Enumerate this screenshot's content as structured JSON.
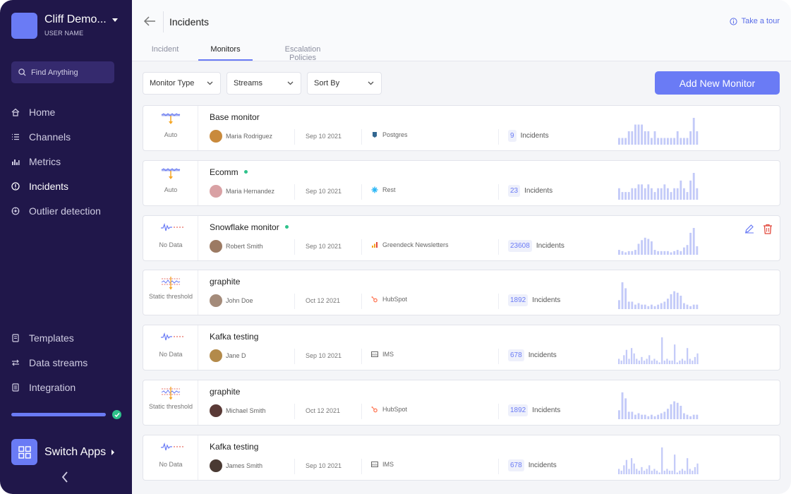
{
  "workspace": {
    "name": "Cliff Demo...",
    "user": "USER NAME"
  },
  "search": {
    "placeholder": "Find Anything"
  },
  "nav_top": [
    {
      "label": "Home",
      "icon": "home-icon"
    },
    {
      "label": "Channels",
      "icon": "list-icon"
    },
    {
      "label": "Metrics",
      "icon": "chart-icon"
    },
    {
      "label": "Incidents",
      "icon": "alert-circle-icon",
      "active": true
    },
    {
      "label": "Outlier detection",
      "icon": "outlier-icon"
    }
  ],
  "nav_bottom": [
    {
      "label": "Templates",
      "icon": "templates-icon"
    },
    {
      "label": "Data streams",
      "icon": "data-streams-icon"
    },
    {
      "label": "Integration",
      "icon": "integration-icon"
    }
  ],
  "switch_apps": "Switch Apps",
  "header": {
    "title": "Incidents",
    "tour": "Take a tour"
  },
  "tabs": [
    "Incident",
    "Monitors",
    "Escalation Policies"
  ],
  "active_tab": "Monitors",
  "filters": {
    "monitor_type": "Monitor Type",
    "streams": "Streams",
    "sort_by": "Sort By"
  },
  "add_button": "Add New Monitor",
  "incidents_label": "Incidents",
  "colors": {
    "accent": "#6a7bf5",
    "sidebar": "#20174a",
    "online": "#2ec28b",
    "bars": "#c3caf8",
    "delete": "#e2473b"
  },
  "monitors": [
    {
      "type": "Auto",
      "name": "Base monitor",
      "online": false,
      "owner": "Maria Rodriguez",
      "date": "Sep 10 2021",
      "source": "Postgres",
      "source_icon": "postgres-icon",
      "incidents": "9",
      "bars": [
        1,
        1,
        1,
        2,
        2,
        3,
        3,
        3,
        2,
        2,
        1,
        2,
        1,
        1,
        1,
        1,
        1,
        1,
        2,
        1,
        1,
        1,
        2,
        4,
        2
      ]
    },
    {
      "type": "Auto",
      "name": "Ecomm",
      "online": true,
      "owner": "Maria Hernandez",
      "date": "Sep 10 2021",
      "source": "Rest",
      "source_icon": "rest-icon",
      "incidents": "23",
      "bars": [
        3,
        2,
        2,
        2,
        3,
        3,
        4,
        4,
        3,
        4,
        3,
        2,
        3,
        3,
        4,
        3,
        2,
        3,
        3,
        5,
        3,
        2,
        5,
        7,
        3
      ]
    },
    {
      "type": "No Data",
      "name": "Snowflake monitor",
      "online": true,
      "owner": "Robert Smith",
      "date": "Sep 10 2021",
      "source": "Greendeck Newsletters",
      "source_icon": "greendeck-icon",
      "incidents": "23608",
      "bars": [
        4,
        3,
        2,
        3,
        3,
        4,
        9,
        12,
        14,
        13,
        11,
        4,
        3,
        3,
        3,
        3,
        2,
        3,
        4,
        3,
        6,
        8,
        18,
        22,
        7
      ],
      "actions": true
    },
    {
      "type": "Static threshold",
      "name": "graphite",
      "online": false,
      "owner": "John Doe",
      "date": "Oct 12 2021",
      "source": "HubSpot",
      "source_icon": "hubspot-icon",
      "incidents": "1892",
      "bars": [
        6,
        18,
        14,
        5,
        5,
        3,
        4,
        3,
        3,
        2,
        3,
        2,
        3,
        4,
        5,
        7,
        10,
        12,
        11,
        9,
        4,
        3,
        2,
        3,
        3
      ]
    },
    {
      "type": "No Data",
      "name": "Kafka testing",
      "online": false,
      "owner": "Jane D",
      "date": "Sep 10 2021",
      "source": "IMS",
      "source_icon": "ims-icon",
      "incidents": "678",
      "bars": [
        3,
        2,
        5,
        8,
        3,
        9,
        6,
        3,
        2,
        4,
        2,
        3,
        5,
        2,
        3,
        2,
        1,
        15,
        2,
        3,
        2,
        2,
        11,
        1,
        2,
        3,
        2,
        9,
        3,
        2,
        4,
        6
      ]
    },
    {
      "type": "Static threshold",
      "name": "graphite",
      "online": false,
      "owner": "Michael Smith",
      "date": "Oct 12 2021",
      "source": "HubSpot",
      "source_icon": "hubspot-icon",
      "incidents": "1892",
      "bars": [
        6,
        18,
        14,
        5,
        5,
        3,
        4,
        3,
        3,
        2,
        3,
        2,
        3,
        4,
        5,
        7,
        10,
        12,
        11,
        9,
        4,
        3,
        2,
        3,
        3
      ]
    },
    {
      "type": "No Data",
      "name": "Kafka testing",
      "online": false,
      "owner": "James Smith",
      "date": "Sep 10 2021",
      "source": "IMS",
      "source_icon": "ims-icon",
      "incidents": "678",
      "bars": [
        3,
        2,
        5,
        8,
        3,
        9,
        6,
        3,
        2,
        4,
        2,
        3,
        5,
        2,
        3,
        2,
        1,
        15,
        2,
        3,
        2,
        2,
        11,
        1,
        2,
        3,
        2,
        9,
        3,
        2,
        4,
        6
      ]
    }
  ]
}
